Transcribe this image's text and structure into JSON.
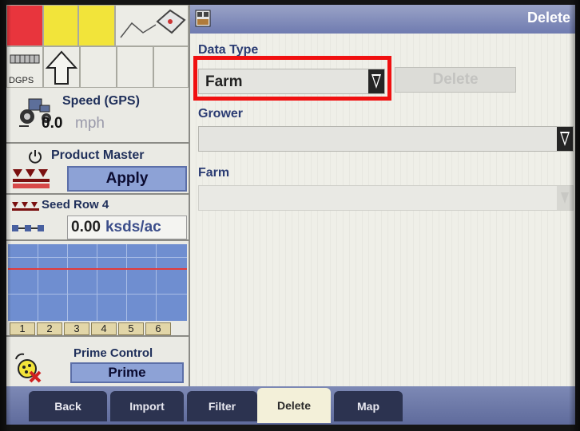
{
  "status": {
    "dgps_label": "DGPS"
  },
  "speed": {
    "title": "Speed (GPS)",
    "value": "0.0",
    "unit": "mph"
  },
  "product_master": {
    "title": "Product Master",
    "button_label": "Apply"
  },
  "seed_row": {
    "title": "Seed Row 4",
    "value": "0.00",
    "unit": "ksds/ac"
  },
  "row_chart": {
    "rows": [
      "1",
      "2",
      "3",
      "4",
      "5",
      "6"
    ]
  },
  "prime_control": {
    "title": "Prime Control",
    "button_label": "Prime"
  },
  "header": {
    "title": "Delete"
  },
  "form": {
    "data_type_label": "Data Type",
    "data_type_value": "Farm",
    "delete_button": "Delete",
    "grower_label": "Grower",
    "grower_value": "",
    "farm_label": "Farm",
    "farm_value": ""
  },
  "tabs": [
    {
      "label": "Back",
      "active": false
    },
    {
      "label": "Import",
      "active": false
    },
    {
      "label": "Filter",
      "active": false
    },
    {
      "label": "Delete",
      "active": true
    },
    {
      "label": "Map",
      "active": false
    }
  ],
  "colors": {
    "highlight": "#f01010",
    "header_blue": "#7f8bbd",
    "status_red": "#e8353d",
    "status_yellow": "#f2e43a"
  }
}
